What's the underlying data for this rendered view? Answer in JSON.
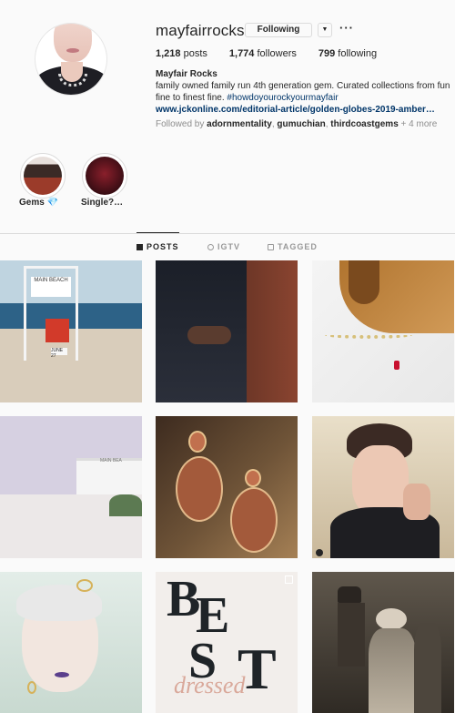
{
  "profile": {
    "username": "mayfairrocks",
    "follow_button": "Following",
    "posts_count": "1,218",
    "posts_label": " posts",
    "followers_count": "1,774",
    "followers_label": " followers",
    "following_count": "799",
    "following_label": " following",
    "full_name": "Mayfair Rocks",
    "bio_line": "family owned family run 4th generation gem. Curated collections from fun fine to finest fine. ",
    "hashtag": "#howdoyourockyourmayfair",
    "website": "www.jckonline.com/editorial-article/golden-globes-2019-amber…",
    "followed_by_prefix": "Followed by ",
    "followed_by_users": [
      "adornmentality",
      "gumuchian",
      "thirdcoastgems"
    ],
    "followed_by_more": " + 4 more"
  },
  "highlights": [
    {
      "label": "Gems",
      "emoji": "💎"
    },
    {
      "label": "Single?…"
    }
  ],
  "tabs": [
    {
      "label": "POSTS",
      "active": true
    },
    {
      "label": "IGTV",
      "active": false
    },
    {
      "label": "TAGGED",
      "active": false
    }
  ],
  "posts": {
    "t1_sign": "MAIN BEACH",
    "t1_date": "JUNE 27",
    "t4_sign": "MAIN BEA",
    "t8_letters": [
      "B",
      "E",
      "S",
      "T"
    ],
    "t8_script": "dressed"
  },
  "colors": {
    "accent_link": "#003569",
    "text_primary": "#262626",
    "text_secondary": "#8e8e8e",
    "border": "#dbdbdb"
  }
}
